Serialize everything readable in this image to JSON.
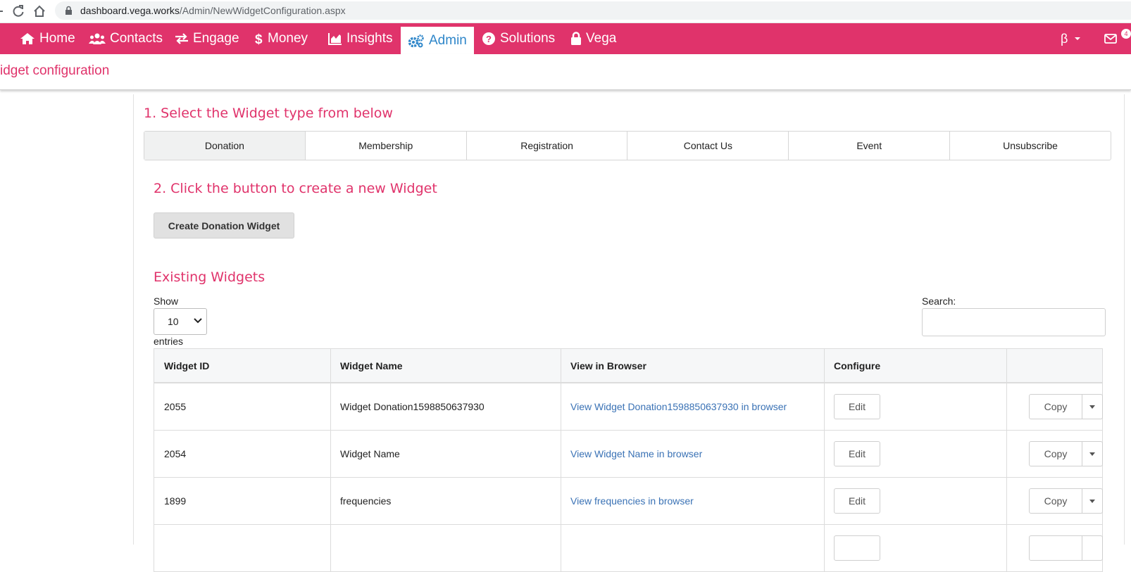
{
  "browser": {
    "url_host": "dashboard.vega.works",
    "url_path": "/Admin/NewWidgetConfiguration.aspx"
  },
  "nav": {
    "items": [
      {
        "label": "Home",
        "icon": "home-icon"
      },
      {
        "label": "Contacts",
        "icon": "users-icon"
      },
      {
        "label": "Engage",
        "icon": "exchange-icon"
      },
      {
        "label": "Money",
        "icon": "dollar-icon"
      },
      {
        "label": "Insights",
        "icon": "chart-icon"
      },
      {
        "label": "Admin",
        "icon": "cogs-icon",
        "active": true
      },
      {
        "label": "Solutions",
        "icon": "question-icon"
      },
      {
        "label": "Vega",
        "icon": "lock-icon"
      }
    ],
    "beta_label": "β",
    "mail_badge": "4",
    "colors": {
      "bar": "#e0336b",
      "active_text": "#2e86c9"
    }
  },
  "page": {
    "title": "idget configuration"
  },
  "step1": {
    "heading": "1. Select the Widget type from below",
    "tabs": [
      "Donation",
      "Membership",
      "Registration",
      "Contact Us",
      "Event",
      "Unsubscribe"
    ],
    "selected": "Donation"
  },
  "step2": {
    "heading": "2. Click the button to create a new Widget",
    "button_label": "Create Donation Widget"
  },
  "existing": {
    "heading": "Existing Widgets",
    "show_label": "Show",
    "page_size": "10",
    "entries_label": "entries",
    "search_label": "Search:",
    "search_value": "",
    "columns": [
      "Widget ID",
      "Widget Name",
      "View in Browser",
      "Configure",
      ""
    ],
    "rows": [
      {
        "id": "2055",
        "name": "Widget Donation1598850637930",
        "view": "View Widget Donation1598850637930 in browser",
        "edit": "Edit",
        "copy": "Copy"
      },
      {
        "id": "2054",
        "name": "Widget Name",
        "view": "View Widget Name in browser",
        "edit": "Edit",
        "copy": "Copy"
      },
      {
        "id": "1899",
        "name": "frequencies",
        "view": "View frequencies in browser",
        "edit": "Edit",
        "copy": "Copy"
      }
    ]
  }
}
